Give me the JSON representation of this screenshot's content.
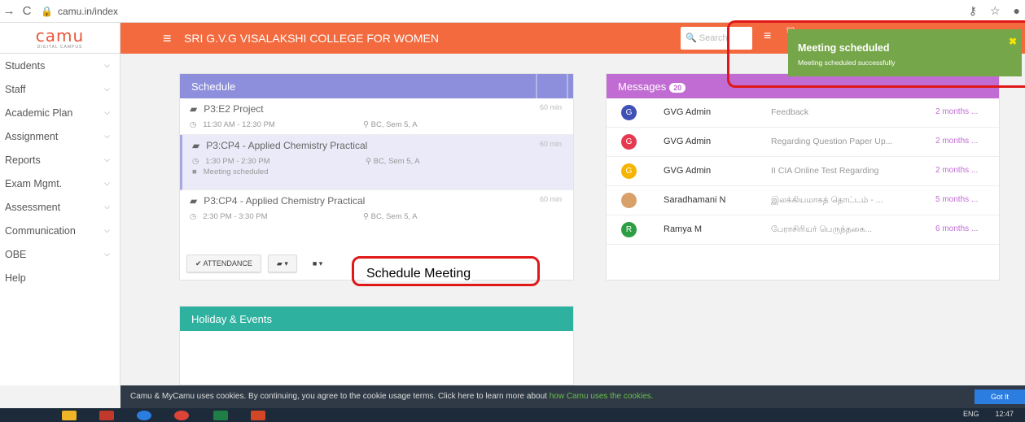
{
  "browser": {
    "url": "camu.in/index",
    "back_icon": "arrow-right-icon",
    "reload_icon": "reload-icon"
  },
  "header": {
    "logo_text": "camu",
    "logo_sub": "DIGITAL CAMPUS",
    "college_name": "SRI G.V.G VISALAKSHI COLLEGE FOR WOMEN",
    "search_placeholder": "Search",
    "notif_count": "92",
    "accent": "#f26a3e"
  },
  "sidebar": {
    "items": [
      {
        "label": "Students"
      },
      {
        "label": "Staff"
      },
      {
        "label": "Academic Plan"
      },
      {
        "label": "Assignment"
      },
      {
        "label": "Reports"
      },
      {
        "label": "Exam Mgmt."
      },
      {
        "label": "Assessment"
      },
      {
        "label": "Communication"
      },
      {
        "label": "OBE"
      },
      {
        "label": "Help"
      }
    ]
  },
  "schedule": {
    "title": "Schedule",
    "items": [
      {
        "title": "P3:E2 Project",
        "duration": "60 min",
        "time": "11:30 AM - 12:30 PM",
        "room": "BC, Sem 5, A",
        "note": ""
      },
      {
        "title": "P3:CP4 - Applied Chemistry Practical",
        "duration": "60 min",
        "time": "1:30 PM - 2:30 PM",
        "room": "BC, Sem 5, A",
        "note": "Meeting scheduled"
      },
      {
        "title": "P3:CP4 - Applied Chemistry Practical",
        "duration": "60 min",
        "time": "2:30 PM - 3:30 PM",
        "room": "BC, Sem 5, A",
        "note": ""
      }
    ],
    "attendance_label": "✔ ATTENDANCE",
    "book_label": "▾",
    "video_label": "▾"
  },
  "messages": {
    "title": "Messages",
    "count": "20",
    "rows": [
      {
        "avatar": "G",
        "color": "#3f51b5",
        "name": "GVG Admin",
        "subject": "Feedback",
        "time": "2 months ..."
      },
      {
        "avatar": "G",
        "color": "#e53950",
        "name": "GVG Admin",
        "subject": "Regarding Question Paper Up...",
        "time": "2 months ..."
      },
      {
        "avatar": "G",
        "color": "#f5b400",
        "name": "GVG Admin",
        "subject": "II CIA Online Test Regarding",
        "time": "2 months ..."
      },
      {
        "avatar": "",
        "color": "#d9a06a",
        "name": "Saradhamani N",
        "subject": "இலக்கியமாகத் தொட்டம் - ...",
        "time": "5 months ..."
      },
      {
        "avatar": "R",
        "color": "#2e9e45",
        "name": "Ramya M",
        "subject": "பேராசிரியர் பெருந்தகை...",
        "time": "6 months ..."
      }
    ]
  },
  "holiday": {
    "title": "Holiday & Events"
  },
  "toast": {
    "title": "Meeting scheduled",
    "text": "Meeting scheduled successfully",
    "close": "✖",
    "color": "#76a64a"
  },
  "annotation": {
    "label": "Schedule Meeting",
    "color": "#e01818"
  },
  "cookie": {
    "text": "Camu & MyCamu uses cookies. By continuing, you agree to the cookie usage terms. Click here to learn more about ",
    "link": "how Camu uses the cookies.",
    "button": "Got It"
  },
  "taskbar": {
    "lang": "ENG",
    "time": "12:47"
  }
}
